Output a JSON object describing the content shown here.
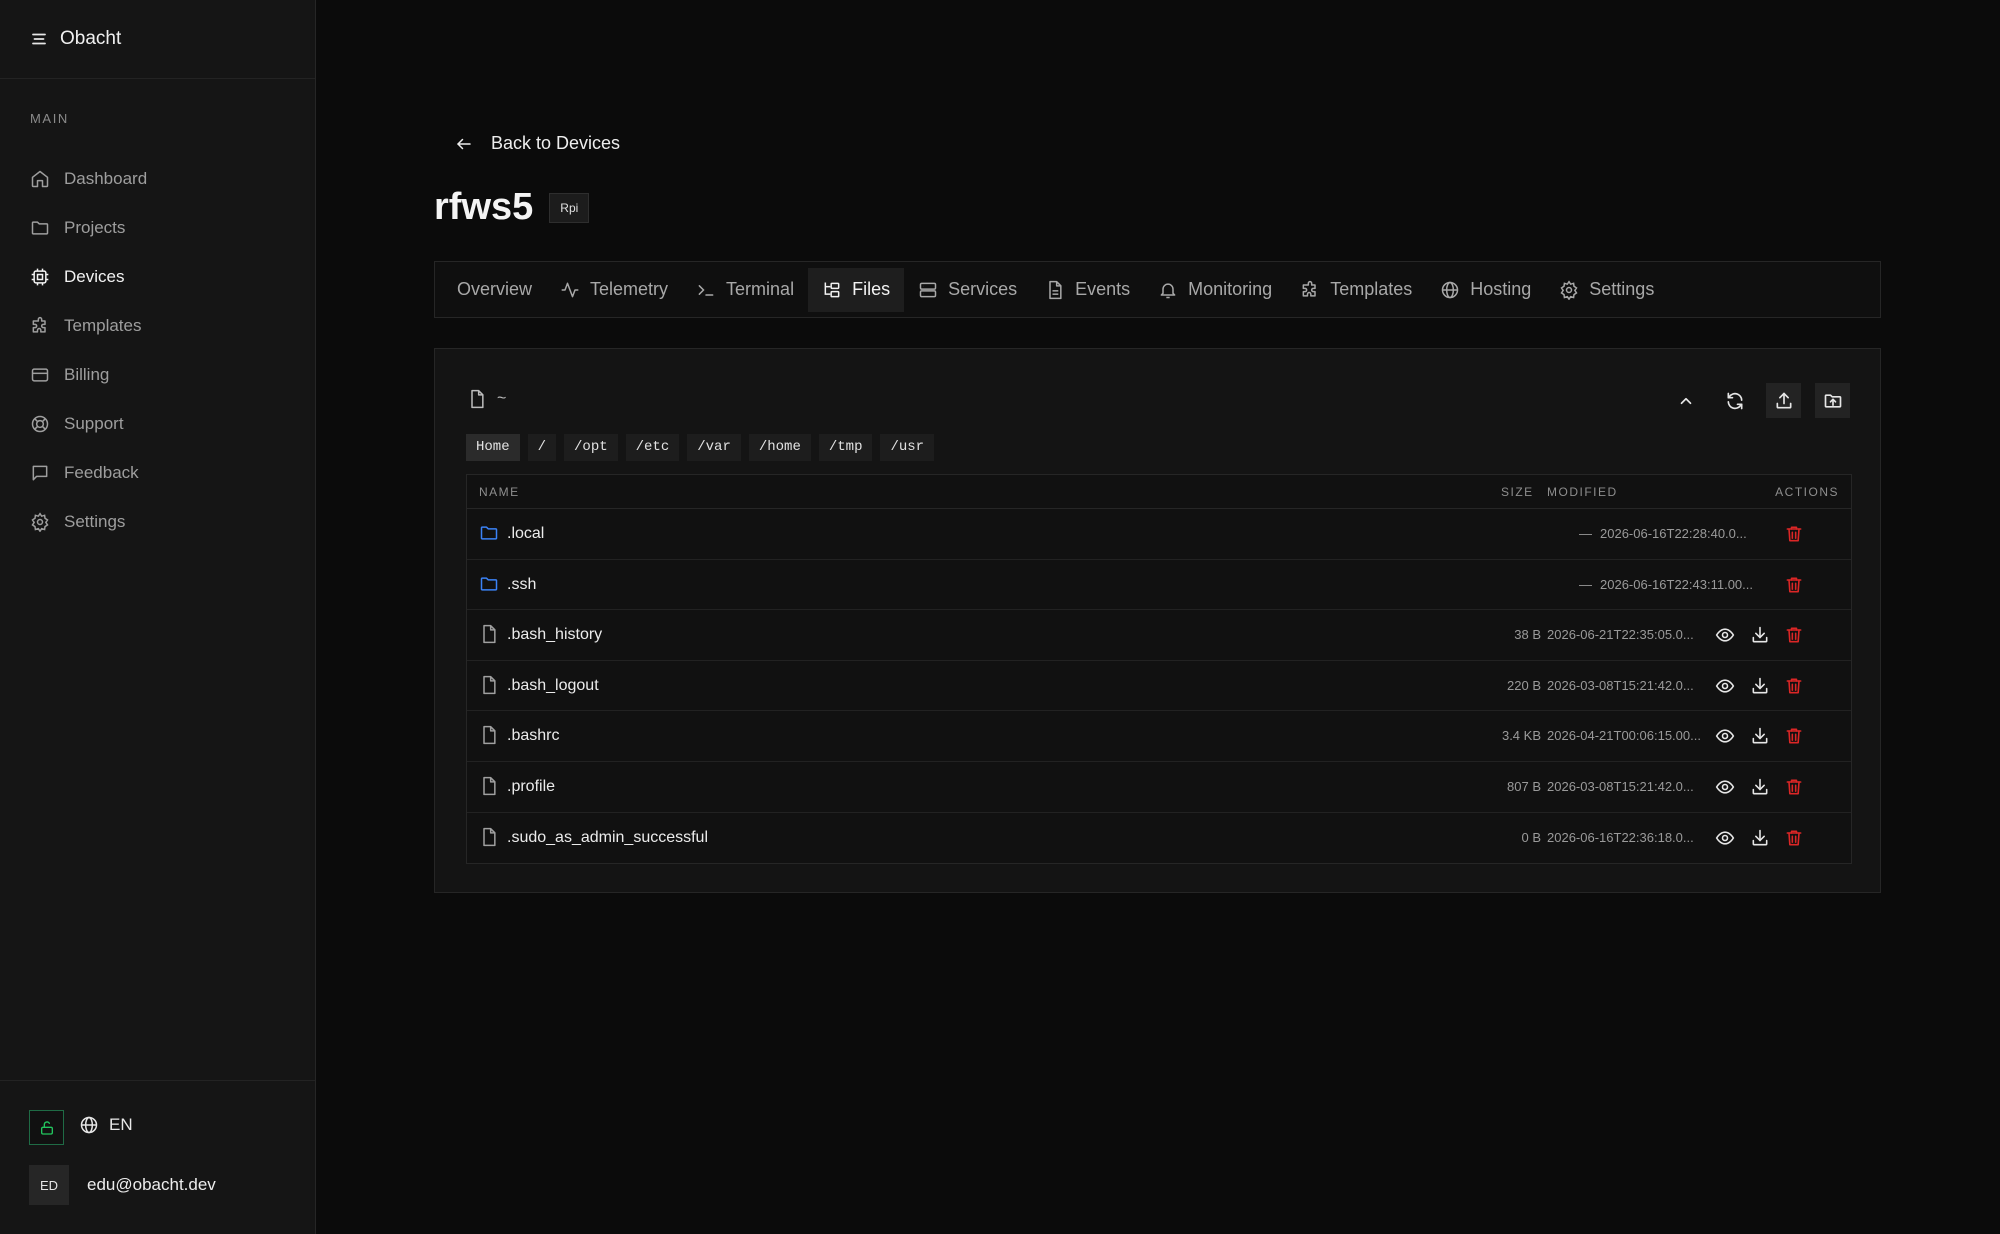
{
  "app": {
    "name": "Obacht"
  },
  "sidebar": {
    "section_label": "MAIN",
    "items": [
      {
        "label": "Dashboard",
        "icon": "home-icon"
      },
      {
        "label": "Projects",
        "icon": "folder-icon"
      },
      {
        "label": "Devices",
        "icon": "cpu-icon",
        "active": true
      },
      {
        "label": "Templates",
        "icon": "puzzle-icon"
      },
      {
        "label": "Billing",
        "icon": "credit-card-icon"
      },
      {
        "label": "Support",
        "icon": "life-buoy-icon"
      },
      {
        "label": "Feedback",
        "icon": "message-square-icon"
      },
      {
        "label": "Settings",
        "icon": "gear-icon"
      }
    ],
    "language": "EN",
    "user": {
      "initials": "ED",
      "email": "edu@obacht.dev"
    }
  },
  "header": {
    "back_label": "Back to Devices",
    "device_name": "rfws5",
    "device_badge": "Rpi"
  },
  "tabs": [
    {
      "label": "Overview",
      "icon": ""
    },
    {
      "label": "Telemetry",
      "icon": "activity-icon"
    },
    {
      "label": "Terminal",
      "icon": "terminal-icon"
    },
    {
      "label": "Files",
      "icon": "folder-tree-icon",
      "active": true
    },
    {
      "label": "Services",
      "icon": "server-icon"
    },
    {
      "label": "Events",
      "icon": "file-text-icon"
    },
    {
      "label": "Monitoring",
      "icon": "bell-icon"
    },
    {
      "label": "Templates",
      "icon": "puzzle-icon"
    },
    {
      "label": "Hosting",
      "icon": "globe-icon"
    },
    {
      "label": "Settings",
      "icon": "gear-icon"
    }
  ],
  "files": {
    "current_path": "~",
    "quick_paths": [
      "Home",
      "/",
      "/opt",
      "/etc",
      "/var",
      "/home",
      "/tmp",
      "/usr"
    ],
    "columns": {
      "name": "NAME",
      "size": "SIZE",
      "modified": "MODIFIED",
      "actions": "ACTIONS"
    },
    "rows": [
      {
        "name": ".local",
        "type": "dir",
        "size": "—",
        "modified": "2026-06-16T22:28:40.0..."
      },
      {
        "name": ".ssh",
        "type": "dir",
        "size": "—",
        "modified": "2026-06-16T22:43:11.00..."
      },
      {
        "name": ".bash_history",
        "type": "file",
        "size": "38 B",
        "modified": "2026-06-21T22:35:05.0..."
      },
      {
        "name": ".bash_logout",
        "type": "file",
        "size": "220 B",
        "modified": "2026-03-08T15:21:42.0..."
      },
      {
        "name": ".bashrc",
        "type": "file",
        "size": "3.4 KB",
        "modified": "2026-04-21T00:06:15.00..."
      },
      {
        "name": ".profile",
        "type": "file",
        "size": "807 B",
        "modified": "2026-03-08T15:21:42.0..."
      },
      {
        "name": ".sudo_as_admin_successful",
        "type": "file",
        "size": "0 B",
        "modified": "2026-06-16T22:36:18.0..."
      }
    ]
  },
  "colors": {
    "background": "#0b0b0b",
    "sidebar": "#151515",
    "folder": "#3b82f6",
    "danger": "#dc2626",
    "accent_green": "#22c55e"
  }
}
